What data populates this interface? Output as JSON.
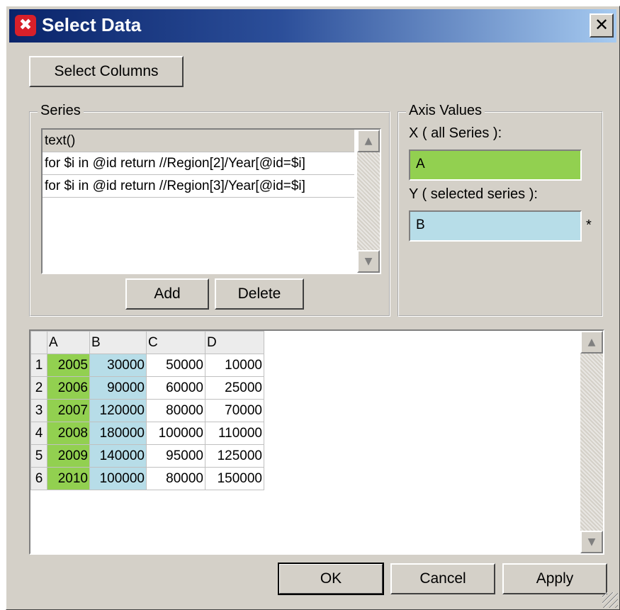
{
  "window": {
    "title": "Select Data",
    "close_glyph": "✕",
    "icon": "app-logo-icon"
  },
  "buttons": {
    "select_columns": "Select Columns",
    "add": "Add",
    "delete": "Delete",
    "ok": "OK",
    "cancel": "Cancel",
    "apply": "Apply"
  },
  "series": {
    "label": "Series",
    "items": [
      "text()",
      "for $i in @id return //Region[2]/Year[@id=$i]",
      "for $i in @id return //Region[3]/Year[@id=$i]"
    ],
    "selected_index": 0
  },
  "axis": {
    "label": "Axis Values",
    "x_label": "X ( all Series ):",
    "x_value": "A",
    "y_label": "Y ( selected series ):",
    "y_value": "B",
    "y_marker": "*"
  },
  "grid": {
    "columns": [
      "A",
      "B",
      "C",
      "D"
    ],
    "rows": [
      {
        "n": "1",
        "cells": [
          "2005",
          "30000",
          "50000",
          "10000"
        ]
      },
      {
        "n": "2",
        "cells": [
          "2006",
          "90000",
          "60000",
          "25000"
        ]
      },
      {
        "n": "3",
        "cells": [
          "2007",
          "120000",
          "80000",
          "70000"
        ]
      },
      {
        "n": "4",
        "cells": [
          "2008",
          "180000",
          "100000",
          "110000"
        ]
      },
      {
        "n": "5",
        "cells": [
          "2009",
          "140000",
          "95000",
          "125000"
        ]
      },
      {
        "n": "6",
        "cells": [
          "2010",
          "100000",
          "80000",
          "150000"
        ]
      }
    ]
  },
  "colors": {
    "x_column": "#92d050",
    "y_column": "#b7dde8",
    "dialog_bg": "#d4d0c8",
    "title_start": "#0a246a",
    "title_end": "#a6caf0"
  }
}
